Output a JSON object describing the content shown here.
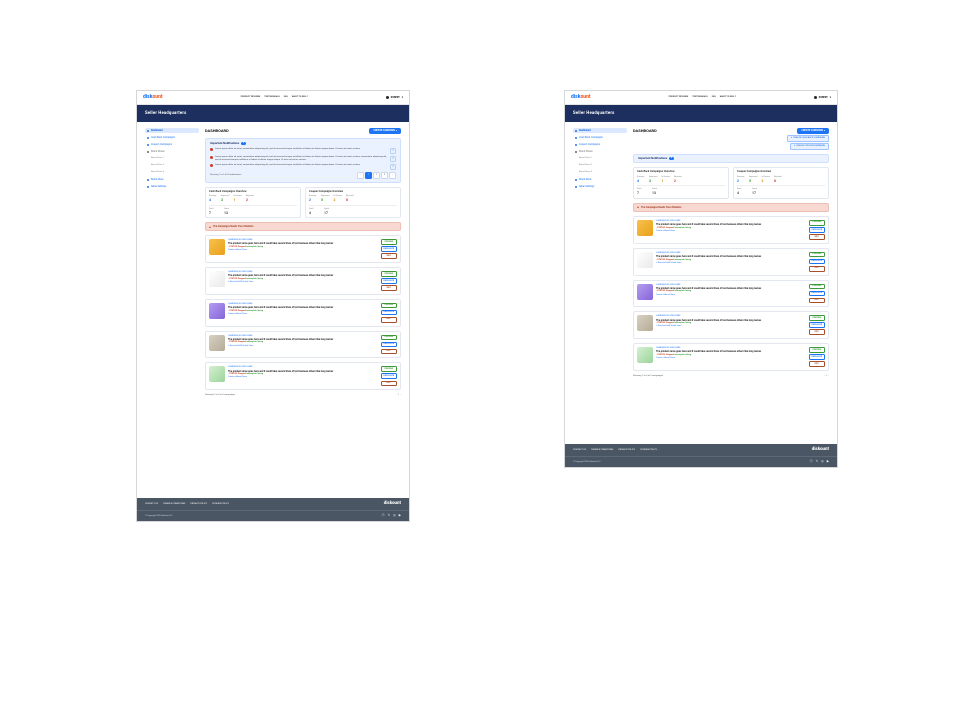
{
  "brand": {
    "part1": "disk",
    "part2": "ount"
  },
  "nav": [
    "PRODUCT REVIEWS",
    "TESTIMONIALS",
    "FAQ",
    "WANT TO SELL?"
  ],
  "account": {
    "name": "ROBERT",
    "caret": "▾"
  },
  "hero": "Seller Headquarters",
  "sidebar": {
    "items": [
      {
        "label": "Dashboard",
        "kind": "active"
      },
      {
        "label": "Cash Back Campaigns",
        "kind": "link"
      },
      {
        "label": "Coupon Campaigns",
        "kind": "link"
      },
      {
        "label": "Brand Stores",
        "kind": "muted"
      },
      {
        "label": "Brand Store 1",
        "kind": "sub"
      },
      {
        "label": "Brand Store 2",
        "kind": "sub"
      },
      {
        "label": "Brand Store 3",
        "kind": "sub"
      },
      {
        "label": "Brand Store",
        "kind": "link"
      },
      {
        "label": "Seller Settings",
        "kind": "link"
      }
    ]
  },
  "title": "DASHBOARD",
  "create_button": "CREATE CAMPAIGN",
  "create_menu": [
    {
      "label": "CREATE CASH BACK CAMPAIGN"
    },
    {
      "label": "CREATE COUPON CAMPAIGN"
    }
  ],
  "notifications": {
    "title": "Important Notifications",
    "count": "4",
    "rows": [
      "Lorem ipsum dolor sit amet, consectetur adipiscing elit, sed do eiusmod tempor incididunt ut labore et dolore magna aliqua. Ut enim ad minim veniam.",
      "Lorem ipsum dolor sit amet, consectetur adipiscing elit, sed do eiusmod tempor incididunt ut labore et dolore magna aliqua. Ut enim ad minim veniam consectetur adipiscing elit, sed do eiusmod tempor incididunt ut labore et dolore magna aliqua. Ut enim ad minim veniam.",
      "Lorem ipsum dolor sit amet, consectetur adipiscing elit, sed do eiusmod tempor incididunt ut labore et dolore magna aliqua. Ut enim ad minim veniam."
    ],
    "pager_label": "Showing 1 to 3 of 8 notifications"
  },
  "overview": [
    {
      "title": "Cash Back Campaigns Overview",
      "cols": [
        {
          "label": "Running",
          "value": "4",
          "color": "c-blue"
        },
        {
          "label": "Approved",
          "value": "3",
          "color": "c-green"
        },
        {
          "label": "In Review",
          "value": "1",
          "color": "c-orange"
        },
        {
          "label": "Rejected",
          "value": "2",
          "color": "c-red"
        }
      ],
      "footer": [
        {
          "label": "Draft",
          "value": "7"
        },
        {
          "label": "Spent",
          "value": "13"
        }
      ]
    },
    {
      "title": "Coupon Campaigns Overview",
      "cols": [
        {
          "label": "Running",
          "value": "2",
          "color": "c-blue"
        },
        {
          "label": "Approved",
          "value": "5",
          "color": "c-green"
        },
        {
          "label": "In Review",
          "value": "2",
          "color": "c-orange"
        },
        {
          "label": "Rejected",
          "value": "0",
          "color": "c-red"
        }
      ],
      "footer": [
        {
          "label": "Draft",
          "value": "4"
        },
        {
          "label": "Spent",
          "value": "17"
        }
      ]
    }
  ],
  "attention_banner": "The Campaigns Needs Your Attention",
  "campaigns": [
    {
      "thumb": "th1",
      "id": "CAMPAIGN ID GOES HERE",
      "name": "The product name goes here and it could take several lines of text because others like long names",
      "remark": "Create a Brand Store"
    },
    {
      "thumb": "th2",
      "id": "CAMPAIGN ID GOES HERE",
      "name": "The product name goes here and it could take several lines of text because others like long names",
      "remark": "+ Need to Refill! Initial Store"
    },
    {
      "thumb": "th3",
      "id": "CAMPAIGN ID GOES HERE",
      "name": "The product name goes here and it could take several lines of text because others like long names",
      "remark": "Create a Brand Store"
    },
    {
      "thumb": "th4",
      "id": "CAMPAIGN ID GOES HERE",
      "name": "The product name goes here and it could take several lines of text because others like long names",
      "remark": "+ Need to Refill! Initial Store"
    },
    {
      "thumb": "th5",
      "id": "CAMPAIGN ID GOES HERE",
      "name": "The product name goes here and it could take several lines of text because others like long names",
      "remark": "Create a Brand Store"
    }
  ],
  "campaign_status": {
    "s1": "• STATUS: Stopped",
    "s2": "Incomplete listing"
  },
  "action_labels": {
    "preview": "PREVIEW",
    "duplicate": "DUPLICATE",
    "edit": "EDIT"
  },
  "bottom_pager": "Showing 1 to 5 of 5 campaigns",
  "footer_links": [
    "CONTACT US",
    "TERMS & CONDITIONS",
    "PRIVACY POLICY",
    "COOKIES POLICY"
  ],
  "copyright": "© Copyright 2020 diskount LLC",
  "icons": {
    "prev": "‹",
    "next": "›"
  }
}
